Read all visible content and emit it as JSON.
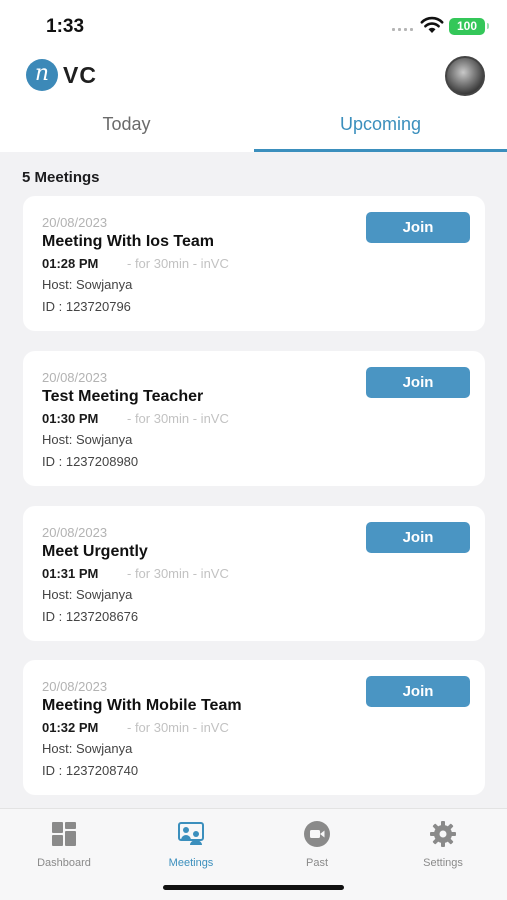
{
  "status_bar": {
    "time": "1:33",
    "battery": "100"
  },
  "header": {
    "logo_mark": "n",
    "logo_text": "VC"
  },
  "tabs": [
    {
      "label": "Today",
      "active": false
    },
    {
      "label": "Upcoming",
      "active": true
    }
  ],
  "meetings_count": "5 Meetings",
  "meetings": [
    {
      "date": "20/08/2023",
      "title": "Meeting With Ios Team",
      "time": "01:28 PM",
      "duration": "- for 30min - inVC",
      "host": "Host: Sowjanya",
      "id": "ID : 123720796",
      "join_label": "Join"
    },
    {
      "date": "20/08/2023",
      "title": "Test Meeting Teacher",
      "time": "01:30 PM",
      "duration": "- for 30min - inVC",
      "host": "Host: Sowjanya",
      "id": "ID : 1237208980",
      "join_label": "Join"
    },
    {
      "date": "20/08/2023",
      "title": "Meet Urgently",
      "time": "01:31 PM",
      "duration": "- for 30min - inVC",
      "host": "Host: Sowjanya",
      "id": "ID : 1237208676",
      "join_label": "Join"
    },
    {
      "date": "20/08/2023",
      "title": "Meeting With Mobile Team",
      "time": "01:32 PM",
      "duration": "- for 30min - inVC",
      "host": "Host: Sowjanya",
      "id": "ID : 1237208740",
      "join_label": "Join"
    }
  ],
  "tab_bar": [
    {
      "label": "Dashboard",
      "icon": "dashboard-icon",
      "active": false
    },
    {
      "label": "Meetings",
      "icon": "meetings-icon",
      "active": true
    },
    {
      "label": "Past",
      "icon": "video-camera-icon",
      "active": false
    },
    {
      "label": "Settings",
      "icon": "gear-icon",
      "active": false
    }
  ],
  "colors": {
    "accent": "#3b8fbd",
    "join_button": "#4a95c3",
    "battery": "#34c759",
    "inactive": "#8a8a8a"
  }
}
